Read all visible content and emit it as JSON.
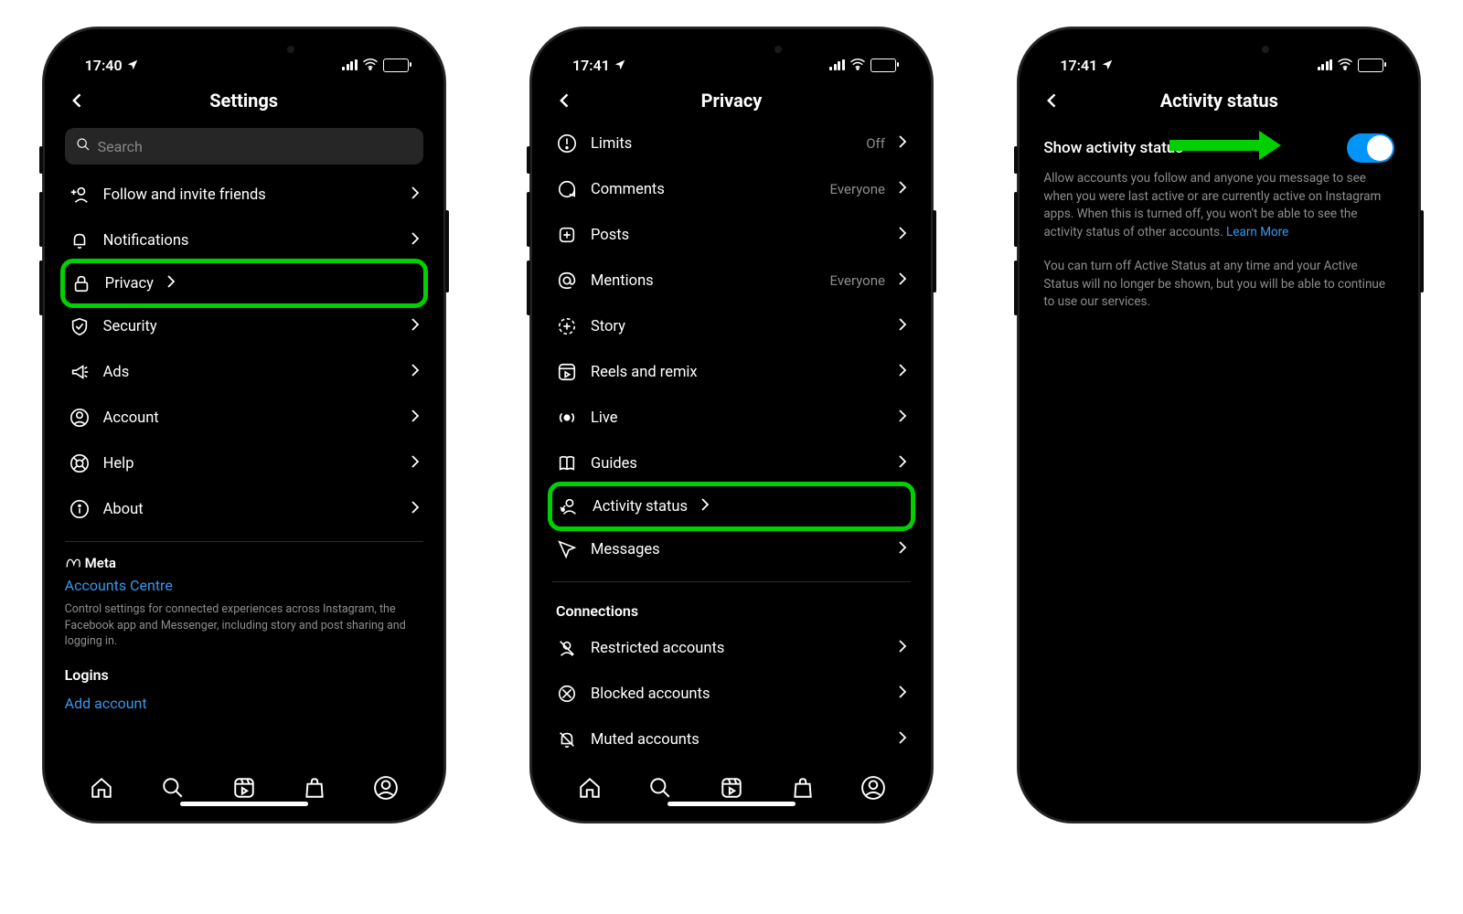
{
  "status": {
    "time1": "17:40",
    "time2": "17:41",
    "time3": "17:41"
  },
  "screen1": {
    "title": "Settings",
    "search_placeholder": "Search",
    "items": {
      "follow": "Follow and invite friends",
      "notifications": "Notifications",
      "privacy": "Privacy",
      "security": "Security",
      "ads": "Ads",
      "account": "Account",
      "help": "Help",
      "about": "About"
    },
    "meta_brand": "Meta",
    "accounts_centre": "Accounts Centre",
    "accounts_desc": "Control settings for connected experiences across Instagram, the Facebook app and Messenger, including story and post sharing and logging in.",
    "logins_header": "Logins",
    "add_account": "Add account"
  },
  "screen2": {
    "title": "Privacy",
    "items": {
      "limits": "Limits",
      "limits_val": "Off",
      "comments": "Comments",
      "comments_val": "Everyone",
      "posts": "Posts",
      "mentions": "Mentions",
      "mentions_val": "Everyone",
      "story": "Story",
      "reels": "Reels and remix",
      "live": "Live",
      "guides": "Guides",
      "activity": "Activity status",
      "messages": "Messages"
    },
    "connections_header": "Connections",
    "connections": {
      "restricted": "Restricted accounts",
      "blocked": "Blocked accounts",
      "muted": "Muted accounts"
    }
  },
  "screen3": {
    "title": "Activity status",
    "toggle_label": "Show activity status",
    "desc": "Allow accounts you follow and anyone you message to see when you were last active or are currently active on Instagram apps. When this is turned off, you won't be able to see the activity status of other accounts. ",
    "learn_more": "Learn More",
    "desc2": "You can turn off Active Status at any time and your Active Status will no longer be shown, but you will be able to continue to use our services."
  }
}
